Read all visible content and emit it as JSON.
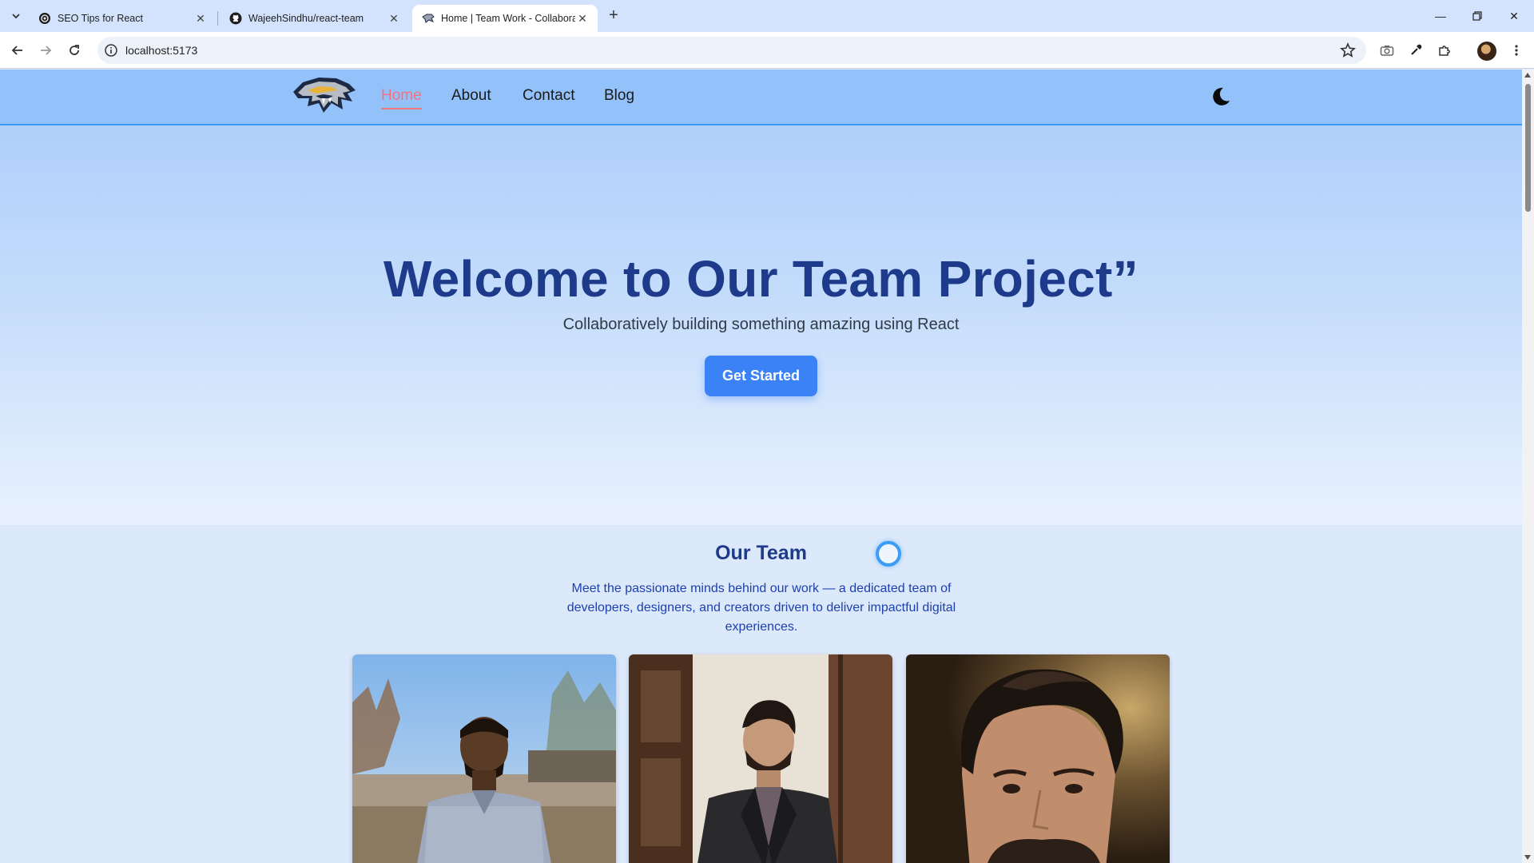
{
  "browser": {
    "tabs": [
      {
        "title": "SEO Tips for React",
        "icon": "openai-icon",
        "active": false
      },
      {
        "title": "WajeehSindhu/react-team",
        "icon": "github-icon",
        "active": false
      },
      {
        "title": "Home | Team Work - Collaborat",
        "icon": "predator-logo-icon",
        "active": true
      }
    ],
    "url": "localhost:5173"
  },
  "nav": {
    "links": [
      {
        "label": "Home",
        "active": true
      },
      {
        "label": "About",
        "active": false
      },
      {
        "label": "Contact",
        "active": false
      },
      {
        "label": "Blog",
        "active": false
      }
    ],
    "active_color": "#f2727f"
  },
  "hero": {
    "title": "Welcome to Our Team Project”",
    "subtitle": "Collaboratively building something amazing using React",
    "cta_label": "Get Started",
    "accent": "#3b82f6",
    "title_color": "#1e3a8a"
  },
  "team": {
    "title": "Our Team",
    "description": "Meet the passionate minds behind our work — a dedicated team of developers, designers, and creators driven to deliver impactful digital experiences.",
    "members": [
      {
        "photo": "member-photo-1"
      },
      {
        "photo": "member-photo-2"
      },
      {
        "photo": "member-photo-3"
      }
    ]
  }
}
